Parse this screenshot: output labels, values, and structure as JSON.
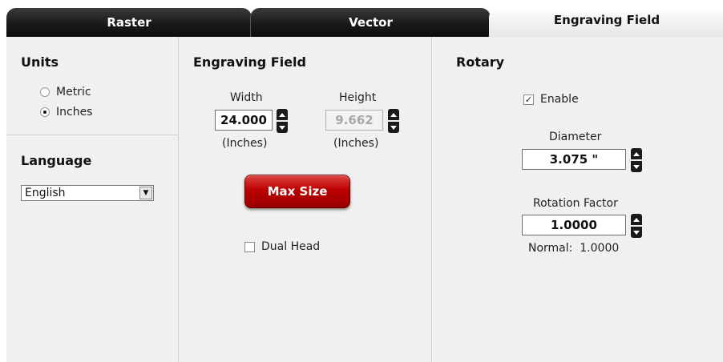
{
  "tabs": [
    {
      "label": "Raster"
    },
    {
      "label": "Vector"
    },
    {
      "label": "Engraving Field"
    }
  ],
  "units": {
    "title": "Units",
    "options": [
      {
        "label": "Metric",
        "selected": false
      },
      {
        "label": "Inches",
        "selected": true
      }
    ]
  },
  "language": {
    "title": "Language",
    "value": "English"
  },
  "engraving_field": {
    "title": "Engraving Field",
    "width_label": "Width",
    "width_value": "24.000",
    "width_unit": "(Inches)",
    "height_label": "Height",
    "height_value": "9.662",
    "height_unit": "(Inches)",
    "max_size_label": "Max Size",
    "dual_head_label": "Dual Head"
  },
  "rotary": {
    "title": "Rotary",
    "enable_label": "Enable",
    "enable_checked": true,
    "diameter_label": "Diameter",
    "diameter_value": "3.075 \"",
    "rotation_factor_label": "Rotation Factor",
    "rotation_factor_value": "1.0000",
    "normal_text": "Normal:  1.0000"
  },
  "colors": {
    "accent_red": "#b00000",
    "tab_dark": "#1a1a1a",
    "panel_bg": "#f0f0f0"
  }
}
